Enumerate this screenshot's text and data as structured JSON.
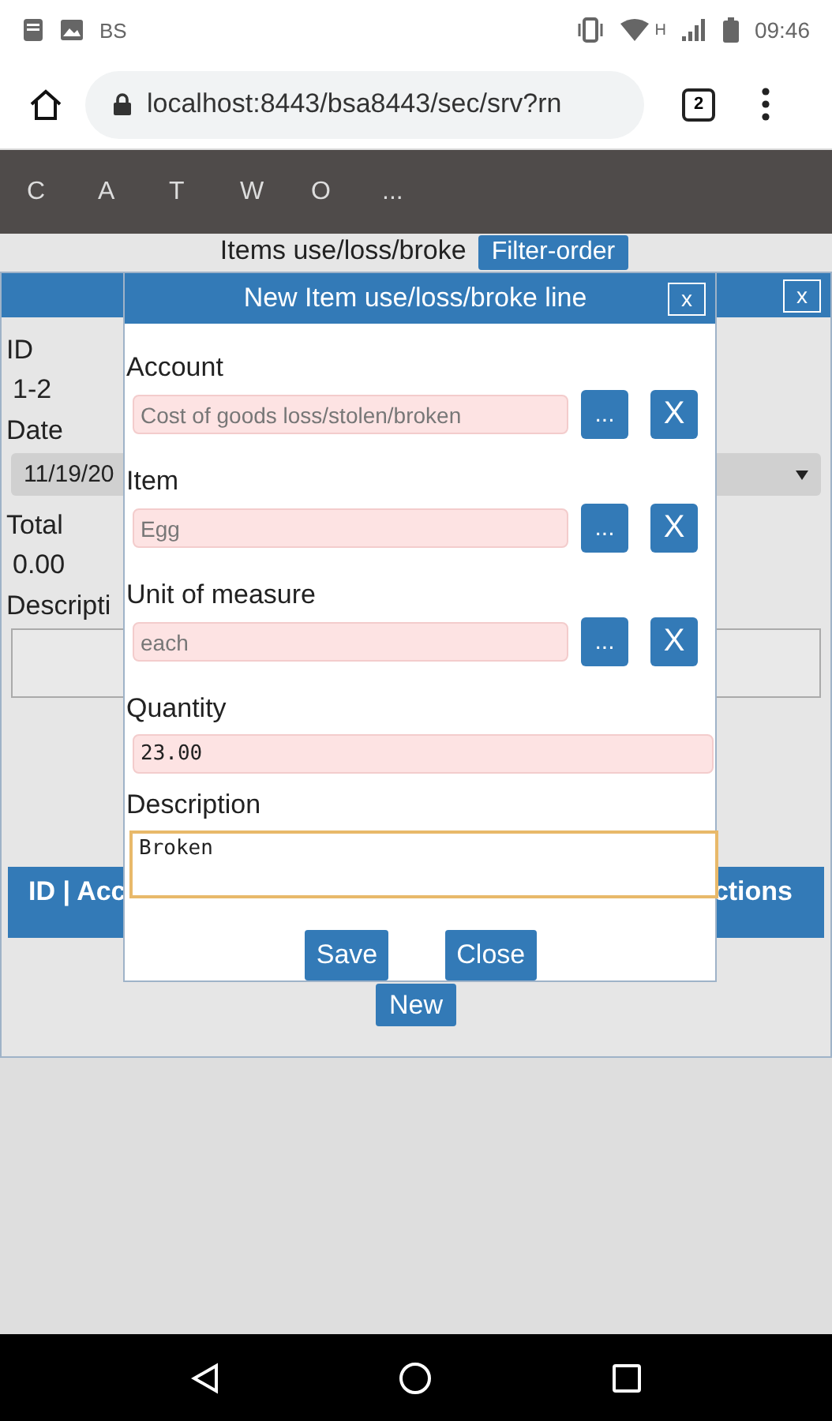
{
  "status_bar": {
    "label": "BS",
    "network": "H",
    "time": "09:46"
  },
  "browser": {
    "url": "localhost:8443/bsa8443/sec/srv?rn",
    "tab_count": "2"
  },
  "nav": {
    "items": [
      "C",
      "A",
      "T",
      "W",
      "O",
      "..."
    ]
  },
  "page": {
    "title": "Items use/loss/broke",
    "filter_button": "Filter-order",
    "new_button": "New"
  },
  "form": {
    "close_button": "x",
    "fields": [
      {
        "label": "ID",
        "value": "1-2",
        "kind": "text"
      },
      {
        "label": "Date",
        "value": "11/19/20",
        "kind": "select"
      },
      {
        "label": "Total",
        "value": "0.00",
        "kind": "text"
      },
      {
        "label": "Descripti",
        "kind": "textarea"
      }
    ],
    "table": {
      "columns": [
        "ID | Acc",
        "ctions"
      ]
    }
  },
  "dialog": {
    "title": "New Item use/loss/broke line",
    "close_button": "x",
    "fields": [
      {
        "label": "Account",
        "value": "Cost of goods loss/stolen/broken",
        "kind": "lookup",
        "pick_button": "...",
        "clear_button": "X"
      },
      {
        "label": "Item",
        "value": "Egg",
        "kind": "lookup",
        "pick_button": "...",
        "clear_button": "X"
      },
      {
        "label": "Unit of measure",
        "value": "each",
        "kind": "lookup",
        "pick_button": "...",
        "clear_button": "X"
      },
      {
        "label": "Quantity",
        "value": "23.00",
        "kind": "input"
      },
      {
        "label": "Description",
        "value": "Broken",
        "kind": "textarea",
        "focused": true
      }
    ],
    "buttons": [
      "Save",
      "Close"
    ]
  }
}
